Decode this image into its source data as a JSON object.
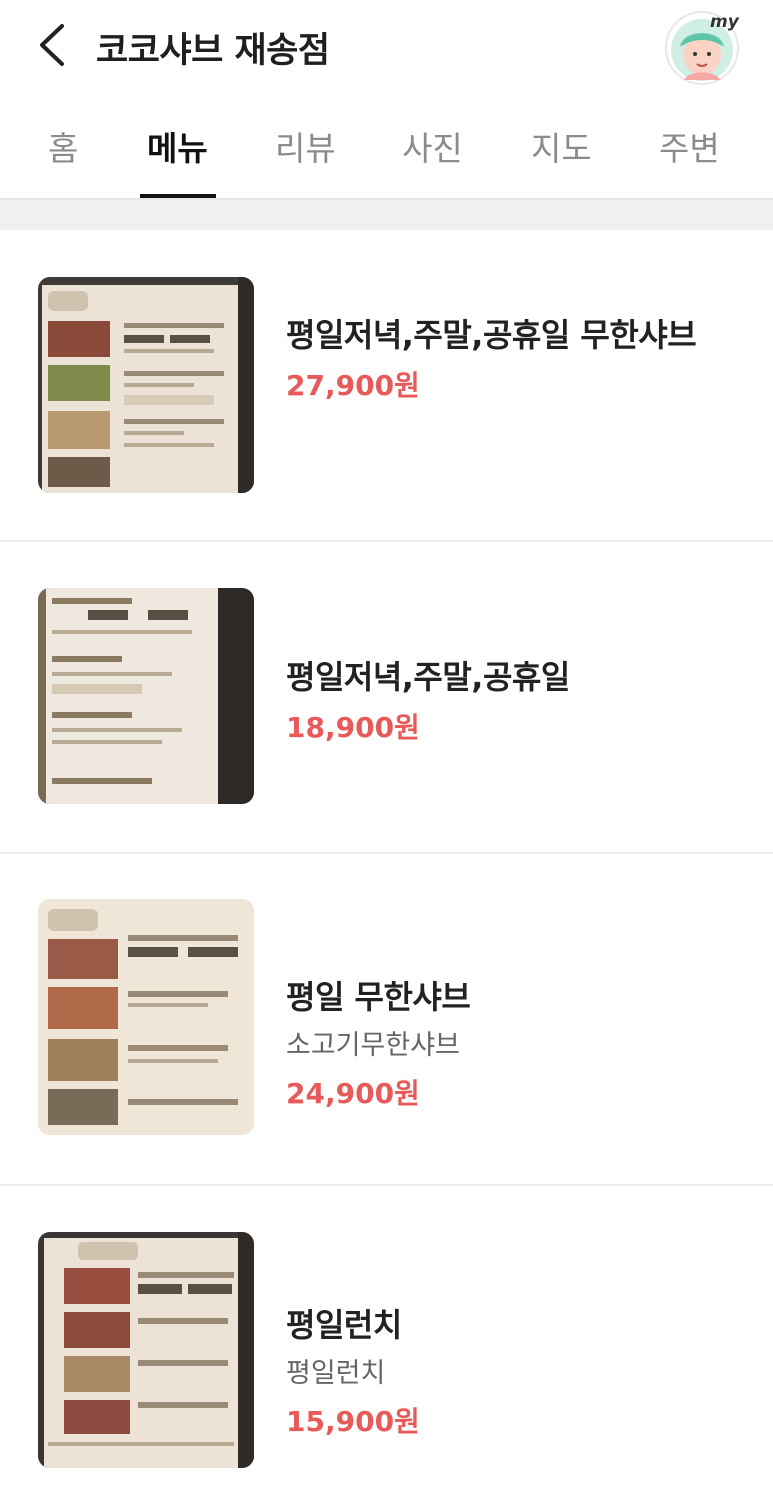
{
  "header": {
    "title": "코코샤브 재송점",
    "avatar_text": "my"
  },
  "tabs": [
    {
      "label": "홈"
    },
    {
      "label": "메뉴"
    },
    {
      "label": "리뷰"
    },
    {
      "label": "사진"
    },
    {
      "label": "지도"
    },
    {
      "label": "주변"
    }
  ],
  "active_tab": "메뉴",
  "menu": [
    {
      "name": "평일저녁,주말,공휴일 무한샤브",
      "description": "",
      "price": "27,900원"
    },
    {
      "name": "평일저녁,주말,공휴일",
      "description": "",
      "price": "18,900원"
    },
    {
      "name": "평일 무한샤브",
      "description": "소고기무한샤브",
      "price": "24,900원"
    },
    {
      "name": "평일런치",
      "description": "평일런치",
      "price": "15,900원"
    }
  ],
  "colors": {
    "price": "#e85a5a",
    "accent": "#111111",
    "separator": "#eef0f2"
  }
}
